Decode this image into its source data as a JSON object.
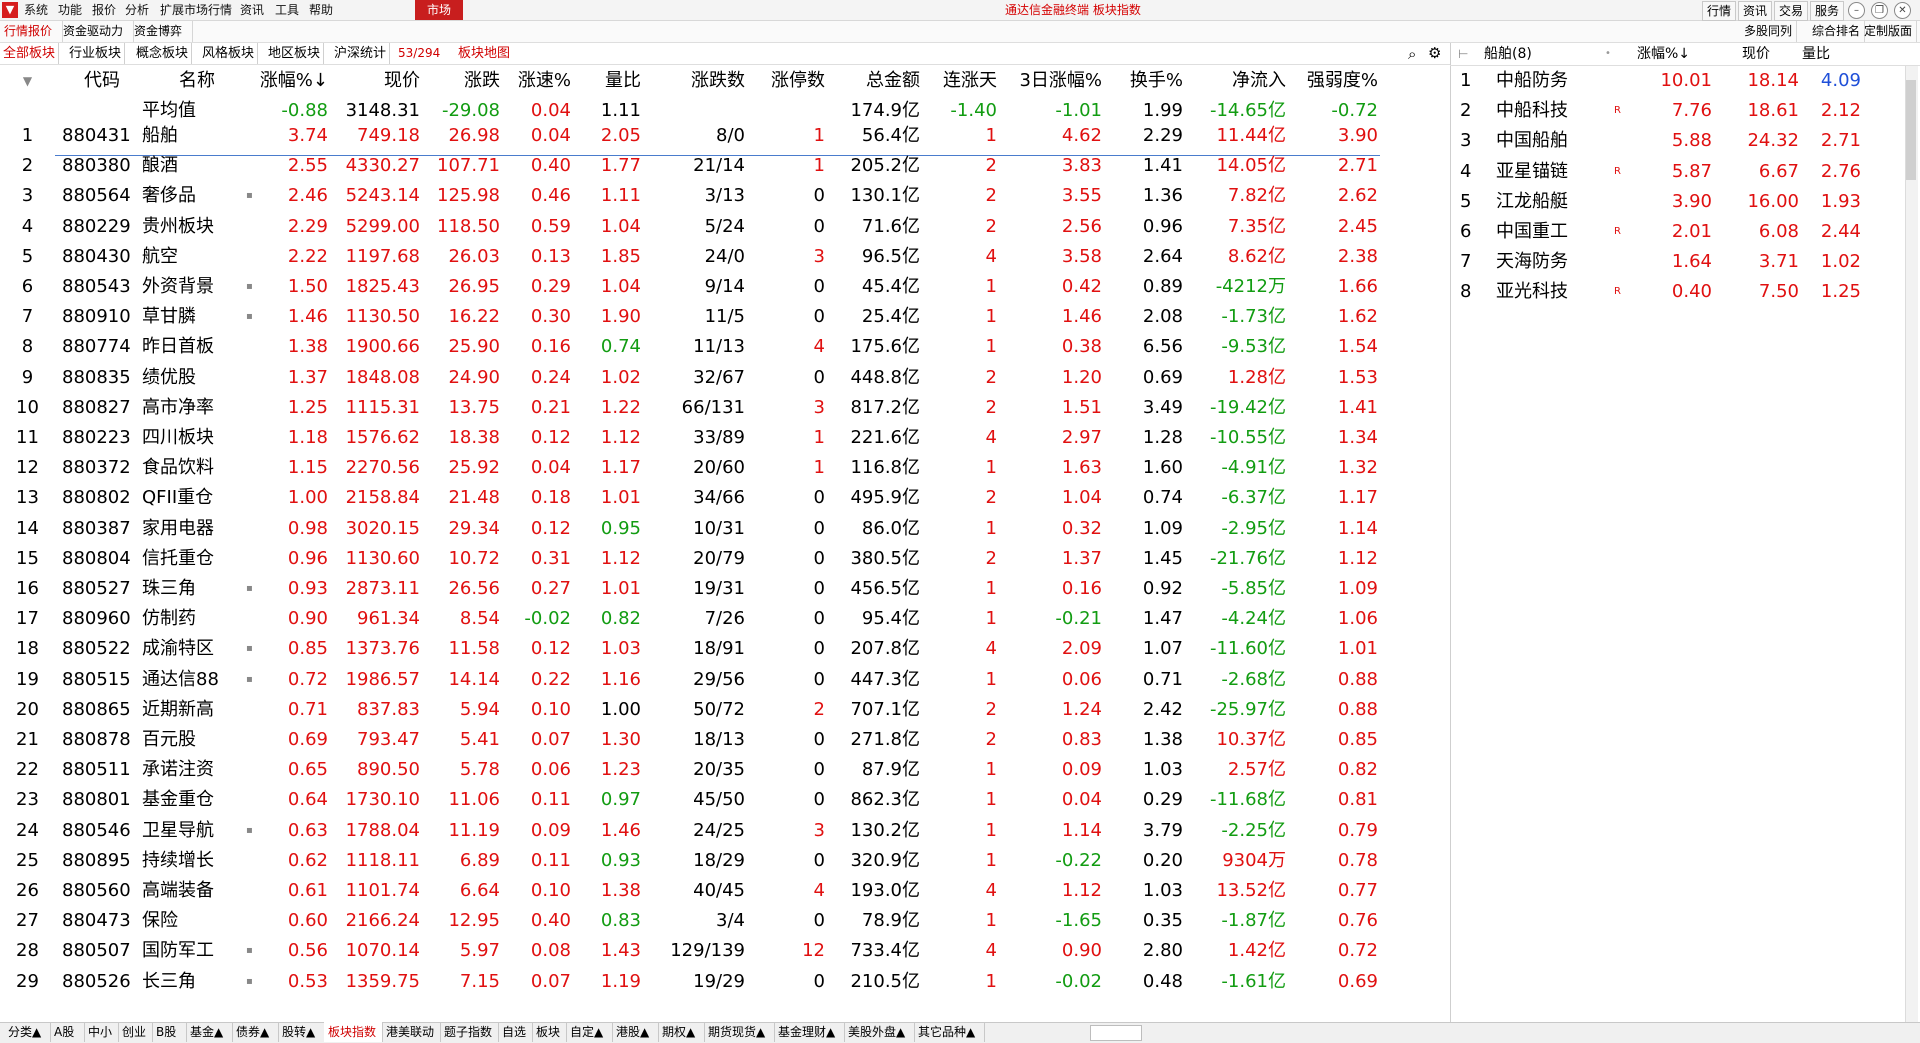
{
  "menu": [
    "系统",
    "功能",
    "报价",
    "分析",
    "扩展市场行情",
    "资讯",
    "工具",
    "帮助"
  ],
  "market_tab": "市场",
  "app_title": "通达信金融终端  板块指数",
  "right_buttons": [
    "行情",
    "资讯",
    "交易",
    "服务"
  ],
  "row2_tabs": [
    "行情报价",
    "资金驱动力",
    "资金博弈"
  ],
  "row3_tabs": [
    "全部板块",
    "行业板块",
    "概念板块",
    "风格板块",
    "地区板块",
    "沪深统计"
  ],
  "row_count": "53/294",
  "block_map": "板块地图",
  "right_top_links": [
    "多股同列",
    "综合排名",
    "定制版面"
  ],
  "columns": [
    "",
    "代码",
    "名称",
    "涨幅%↓",
    "现价",
    "涨跌",
    "涨速%",
    "量比",
    "涨跌数",
    "涨停数",
    "总金额",
    "连涨天",
    "3日涨幅%",
    "换手%",
    "净流入",
    "强弱度%"
  ],
  "average_row": {
    "name": "平均值",
    "chg_pct": "-0.88",
    "price": "3148.31",
    "chg": "-29.08",
    "speed": "0.04",
    "vol_ratio": "1.11",
    "amount": "174.9亿",
    "days": "-1.40",
    "chg3": "-1.01",
    "turnover": "1.99",
    "inflow": "-14.65亿",
    "strength": "-0.72"
  },
  "rows": [
    {
      "n": "1",
      "code": "880431",
      "name": "船舶",
      "dot": false,
      "chg_pct": "3.74",
      "price": "749.18",
      "chg": "26.98",
      "speed": "0.04",
      "vol_ratio": "2.05",
      "updown": "8/0",
      "limit": "1",
      "amount": "56.4亿",
      "days": "1",
      "chg3": "4.62",
      "turnover": "2.29",
      "inflow": "11.44亿",
      "strength": "3.90"
    },
    {
      "n": "2",
      "code": "880380",
      "name": "酿酒",
      "dot": false,
      "chg_pct": "2.55",
      "price": "4330.27",
      "chg": "107.71",
      "speed": "0.40",
      "vol_ratio": "1.77",
      "updown": "21/14",
      "limit": "1",
      "amount": "205.2亿",
      "days": "2",
      "chg3": "3.83",
      "turnover": "1.41",
      "inflow": "14.05亿",
      "strength": "2.71"
    },
    {
      "n": "3",
      "code": "880564",
      "name": "奢侈品",
      "dot": true,
      "chg_pct": "2.46",
      "price": "5243.14",
      "chg": "125.98",
      "speed": "0.46",
      "vol_ratio": "1.11",
      "updown": "3/13",
      "limit": "0",
      "amount": "130.1亿",
      "days": "2",
      "chg3": "3.55",
      "turnover": "1.36",
      "inflow": "7.82亿",
      "strength": "2.62"
    },
    {
      "n": "4",
      "code": "880229",
      "name": "贵州板块",
      "dot": false,
      "chg_pct": "2.29",
      "price": "5299.00",
      "chg": "118.50",
      "speed": "0.59",
      "vol_ratio": "1.04",
      "updown": "5/24",
      "limit": "0",
      "amount": "71.6亿",
      "days": "2",
      "chg3": "2.56",
      "turnover": "0.96",
      "inflow": "7.35亿",
      "strength": "2.45"
    },
    {
      "n": "5",
      "code": "880430",
      "name": "航空",
      "dot": false,
      "chg_pct": "2.22",
      "price": "1197.68",
      "chg": "26.03",
      "speed": "0.13",
      "vol_ratio": "1.85",
      "updown": "24/0",
      "limit": "3",
      "amount": "96.5亿",
      "days": "4",
      "chg3": "3.58",
      "turnover": "2.64",
      "inflow": "8.62亿",
      "strength": "2.38"
    },
    {
      "n": "6",
      "code": "880543",
      "name": "外资背景",
      "dot": true,
      "chg_pct": "1.50",
      "price": "1825.43",
      "chg": "26.95",
      "speed": "0.29",
      "vol_ratio": "1.04",
      "updown": "9/14",
      "limit": "0",
      "amount": "45.4亿",
      "days": "1",
      "chg3": "0.42",
      "turnover": "0.89",
      "inflow": "-4212万",
      "strength": "1.66"
    },
    {
      "n": "7",
      "code": "880910",
      "name": "草甘膦",
      "dot": true,
      "chg_pct": "1.46",
      "price": "1130.50",
      "chg": "16.22",
      "speed": "0.30",
      "vol_ratio": "1.90",
      "updown": "11/5",
      "limit": "0",
      "amount": "25.4亿",
      "days": "1",
      "chg3": "1.46",
      "turnover": "2.08",
      "inflow": "-1.73亿",
      "strength": "1.62"
    },
    {
      "n": "8",
      "code": "880774",
      "name": "昨日首板",
      "dot": false,
      "chg_pct": "1.38",
      "price": "1900.66",
      "chg": "25.90",
      "speed": "0.16",
      "vol_ratio": "0.74",
      "updown": "11/13",
      "limit": "4",
      "amount": "175.6亿",
      "days": "1",
      "chg3": "0.38",
      "turnover": "6.56",
      "inflow": "-9.53亿",
      "strength": "1.54"
    },
    {
      "n": "9",
      "code": "880835",
      "name": "绩优股",
      "dot": false,
      "chg_pct": "1.37",
      "price": "1848.08",
      "chg": "24.90",
      "speed": "0.24",
      "vol_ratio": "1.02",
      "updown": "32/67",
      "limit": "0",
      "amount": "448.8亿",
      "days": "2",
      "chg3": "1.20",
      "turnover": "0.69",
      "inflow": "1.28亿",
      "strength": "1.53"
    },
    {
      "n": "10",
      "code": "880827",
      "name": "高市净率",
      "dot": false,
      "chg_pct": "1.25",
      "price": "1115.31",
      "chg": "13.75",
      "speed": "0.21",
      "vol_ratio": "1.22",
      "updown": "66/131",
      "limit": "3",
      "amount": "817.2亿",
      "days": "2",
      "chg3": "1.51",
      "turnover": "3.49",
      "inflow": "-19.42亿",
      "strength": "1.41"
    },
    {
      "n": "11",
      "code": "880223",
      "name": "四川板块",
      "dot": false,
      "chg_pct": "1.18",
      "price": "1576.62",
      "chg": "18.38",
      "speed": "0.12",
      "vol_ratio": "1.12",
      "updown": "33/89",
      "limit": "1",
      "amount": "221.6亿",
      "days": "4",
      "chg3": "2.97",
      "turnover": "1.28",
      "inflow": "-10.55亿",
      "strength": "1.34"
    },
    {
      "n": "12",
      "code": "880372",
      "name": "食品饮料",
      "dot": false,
      "chg_pct": "1.15",
      "price": "2270.56",
      "chg": "25.92",
      "speed": "0.04",
      "vol_ratio": "1.17",
      "updown": "20/60",
      "limit": "1",
      "amount": "116.8亿",
      "days": "1",
      "chg3": "1.63",
      "turnover": "1.60",
      "inflow": "-4.91亿",
      "strength": "1.32"
    },
    {
      "n": "13",
      "code": "880802",
      "name": "QFII重仓",
      "dot": false,
      "chg_pct": "1.00",
      "price": "2158.84",
      "chg": "21.48",
      "speed": "0.18",
      "vol_ratio": "1.01",
      "updown": "34/66",
      "limit": "0",
      "amount": "495.9亿",
      "days": "2",
      "chg3": "1.04",
      "turnover": "0.74",
      "inflow": "-6.37亿",
      "strength": "1.17"
    },
    {
      "n": "14",
      "code": "880387",
      "name": "家用电器",
      "dot": false,
      "chg_pct": "0.98",
      "price": "3020.15",
      "chg": "29.34",
      "speed": "0.12",
      "vol_ratio": "0.95",
      "updown": "10/31",
      "limit": "0",
      "amount": "86.0亿",
      "days": "1",
      "chg3": "0.32",
      "turnover": "1.09",
      "inflow": "-2.95亿",
      "strength": "1.14"
    },
    {
      "n": "15",
      "code": "880804",
      "name": "信托重仓",
      "dot": false,
      "chg_pct": "0.96",
      "price": "1130.60",
      "chg": "10.72",
      "speed": "0.31",
      "vol_ratio": "1.12",
      "updown": "20/79",
      "limit": "0",
      "amount": "380.5亿",
      "days": "2",
      "chg3": "1.37",
      "turnover": "1.45",
      "inflow": "-21.76亿",
      "strength": "1.12"
    },
    {
      "n": "16",
      "code": "880527",
      "name": "珠三角",
      "dot": true,
      "chg_pct": "0.93",
      "price": "2873.11",
      "chg": "26.56",
      "speed": "0.27",
      "vol_ratio": "1.01",
      "updown": "19/31",
      "limit": "0",
      "amount": "456.5亿",
      "days": "1",
      "chg3": "0.16",
      "turnover": "0.92",
      "inflow": "-5.85亿",
      "strength": "1.09"
    },
    {
      "n": "17",
      "code": "880960",
      "name": "仿制药",
      "dot": false,
      "chg_pct": "0.90",
      "price": "961.34",
      "chg": "8.54",
      "speed": "-0.02",
      "vol_ratio": "0.82",
      "updown": "7/26",
      "limit": "0",
      "amount": "95.4亿",
      "days": "1",
      "chg3": "-0.21",
      "turnover": "1.47",
      "inflow": "-4.24亿",
      "strength": "1.06"
    },
    {
      "n": "18",
      "code": "880522",
      "name": "成渝特区",
      "dot": true,
      "chg_pct": "0.85",
      "price": "1373.76",
      "chg": "11.58",
      "speed": "0.12",
      "vol_ratio": "1.03",
      "updown": "18/91",
      "limit": "0",
      "amount": "207.8亿",
      "days": "4",
      "chg3": "2.09",
      "turnover": "1.07",
      "inflow": "-11.60亿",
      "strength": "1.01"
    },
    {
      "n": "19",
      "code": "880515",
      "name": "通达信88",
      "dot": true,
      "chg_pct": "0.72",
      "price": "1986.57",
      "chg": "14.14",
      "speed": "0.22",
      "vol_ratio": "1.16",
      "updown": "29/56",
      "limit": "0",
      "amount": "447.3亿",
      "days": "1",
      "chg3": "0.06",
      "turnover": "0.71",
      "inflow": "-2.68亿",
      "strength": "0.88"
    },
    {
      "n": "20",
      "code": "880865",
      "name": "近期新高",
      "dot": false,
      "chg_pct": "0.71",
      "price": "837.83",
      "chg": "5.94",
      "speed": "0.10",
      "vol_ratio": "1.00",
      "updown": "50/72",
      "limit": "2",
      "amount": "707.1亿",
      "days": "2",
      "chg3": "1.24",
      "turnover": "2.42",
      "inflow": "-25.97亿",
      "strength": "0.88"
    },
    {
      "n": "21",
      "code": "880878",
      "name": "百元股",
      "dot": false,
      "chg_pct": "0.69",
      "price": "793.47",
      "chg": "5.41",
      "speed": "0.07",
      "vol_ratio": "1.30",
      "updown": "18/13",
      "limit": "0",
      "amount": "271.8亿",
      "days": "2",
      "chg3": "0.83",
      "turnover": "1.38",
      "inflow": "10.37亿",
      "strength": "0.85"
    },
    {
      "n": "22",
      "code": "880511",
      "name": "承诺注资",
      "dot": false,
      "chg_pct": "0.65",
      "price": "890.50",
      "chg": "5.78",
      "speed": "0.06",
      "vol_ratio": "1.23",
      "updown": "20/35",
      "limit": "0",
      "amount": "87.9亿",
      "days": "1",
      "chg3": "0.09",
      "turnover": "1.03",
      "inflow": "2.57亿",
      "strength": "0.82"
    },
    {
      "n": "23",
      "code": "880801",
      "name": "基金重仓",
      "dot": false,
      "chg_pct": "0.64",
      "price": "1730.10",
      "chg": "11.06",
      "speed": "0.11",
      "vol_ratio": "0.97",
      "updown": "45/50",
      "limit": "0",
      "amount": "862.3亿",
      "days": "1",
      "chg3": "0.04",
      "turnover": "0.29",
      "inflow": "-11.68亿",
      "strength": "0.81"
    },
    {
      "n": "24",
      "code": "880546",
      "name": "卫星导航",
      "dot": true,
      "chg_pct": "0.63",
      "price": "1788.04",
      "chg": "11.19",
      "speed": "0.09",
      "vol_ratio": "1.46",
      "updown": "24/25",
      "limit": "3",
      "amount": "130.2亿",
      "days": "1",
      "chg3": "1.14",
      "turnover": "3.79",
      "inflow": "-2.25亿",
      "strength": "0.79"
    },
    {
      "n": "25",
      "code": "880895",
      "name": "持续增长",
      "dot": false,
      "chg_pct": "0.62",
      "price": "1118.11",
      "chg": "6.89",
      "speed": "0.11",
      "vol_ratio": "0.93",
      "updown": "18/29",
      "limit": "0",
      "amount": "320.9亿",
      "days": "1",
      "chg3": "-0.22",
      "turnover": "0.20",
      "inflow": "9304万",
      "strength": "0.78"
    },
    {
      "n": "26",
      "code": "880560",
      "name": "高端装备",
      "dot": false,
      "chg_pct": "0.61",
      "price": "1101.74",
      "chg": "6.64",
      "speed": "0.10",
      "vol_ratio": "1.38",
      "updown": "40/45",
      "limit": "4",
      "amount": "193.0亿",
      "days": "4",
      "chg3": "1.12",
      "turnover": "1.03",
      "inflow": "13.52亿",
      "strength": "0.77"
    },
    {
      "n": "27",
      "code": "880473",
      "name": "保险",
      "dot": false,
      "chg_pct": "0.60",
      "price": "2166.24",
      "chg": "12.95",
      "speed": "0.40",
      "vol_ratio": "0.83",
      "updown": "3/4",
      "limit": "0",
      "amount": "78.9亿",
      "days": "1",
      "chg3": "-1.65",
      "turnover": "0.35",
      "inflow": "-1.87亿",
      "strength": "0.76"
    },
    {
      "n": "28",
      "code": "880507",
      "name": "国防军工",
      "dot": true,
      "chg_pct": "0.56",
      "price": "1070.14",
      "chg": "5.97",
      "speed": "0.08",
      "vol_ratio": "1.43",
      "updown": "129/139",
      "limit": "12",
      "amount": "733.4亿",
      "days": "4",
      "chg3": "0.90",
      "turnover": "2.80",
      "inflow": "1.42亿",
      "strength": "0.72"
    },
    {
      "n": "29",
      "code": "880526",
      "name": "长三角",
      "dot": true,
      "chg_pct": "0.53",
      "price": "1359.75",
      "chg": "7.15",
      "speed": "0.07",
      "vol_ratio": "1.19",
      "updown": "19/29",
      "limit": "0",
      "amount": "210.5亿",
      "days": "1",
      "chg3": "-0.02",
      "turnover": "0.48",
      "inflow": "-1.61亿",
      "strength": "0.69"
    }
  ],
  "right_panel": {
    "title": "船舶(8)",
    "cols": [
      "涨幅%↓",
      "现价",
      "量比"
    ],
    "rows": [
      {
        "n": "1",
        "name": "中船防务",
        "tag": "",
        "chg": "10.01",
        "price": "18.14",
        "vr": "4.09"
      },
      {
        "n": "2",
        "name": "中船科技",
        "tag": "R",
        "chg": "7.76",
        "price": "18.61",
        "vr": "2.12"
      },
      {
        "n": "3",
        "name": "中国船舶",
        "tag": "",
        "chg": "5.88",
        "price": "24.32",
        "vr": "2.71"
      },
      {
        "n": "4",
        "name": "亚星锚链",
        "tag": "R",
        "chg": "5.87",
        "price": "6.67",
        "vr": "2.76"
      },
      {
        "n": "5",
        "name": "江龙船艇",
        "tag": "",
        "chg": "3.90",
        "price": "16.00",
        "vr": "1.93"
      },
      {
        "n": "6",
        "name": "中国重工",
        "tag": "R",
        "chg": "2.01",
        "price": "6.08",
        "vr": "2.44"
      },
      {
        "n": "7",
        "name": "天海防务",
        "tag": "",
        "chg": "1.64",
        "price": "3.71",
        "vr": "1.02"
      },
      {
        "n": "8",
        "name": "亚光科技",
        "tag": "R",
        "chg": "0.40",
        "price": "7.50",
        "vr": "1.25"
      }
    ]
  },
  "bottom_tabs": [
    "分类▲",
    "A股",
    "中小",
    "创业",
    "B股",
    "基金▲",
    "债券▲",
    "股转▲",
    "板块指数",
    "港美联动",
    "题子指数",
    "自选",
    "板块",
    "自定▲",
    "港股▲",
    "期权▲",
    "期货现货▲",
    "基金理财▲",
    "美股外盘▲",
    "其它品种▲"
  ],
  "colors": {
    "up": "#e01010",
    "down": "#129c12",
    "accent": "#c81e1e"
  }
}
